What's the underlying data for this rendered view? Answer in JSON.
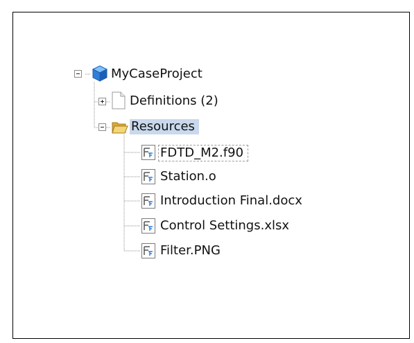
{
  "tree": {
    "root": {
      "label": "MyCaseProject",
      "icon": "project-cube-icon",
      "expanded": true
    },
    "children": [
      {
        "label": "Definitions (2)",
        "icon": "document-icon",
        "expanded": false
      },
      {
        "label": "Resources",
        "icon": "open-folder-icon",
        "expanded": true,
        "selected": true,
        "items": [
          {
            "label": "FDTD_M2.f90",
            "icon": "fortran-file-icon",
            "focused": true
          },
          {
            "label": "Station.o",
            "icon": "fortran-file-icon"
          },
          {
            "label": "Introduction Final.docx",
            "icon": "fortran-file-icon"
          },
          {
            "label": "Control Settings.xlsx",
            "icon": "fortran-file-icon"
          },
          {
            "label": "Filter.PNG",
            "icon": "fortran-file-icon"
          }
        ]
      }
    ]
  },
  "colors": {
    "selection": "#c9d8ec",
    "cube": "#2f7fd6",
    "folder": "#e8c25a"
  }
}
